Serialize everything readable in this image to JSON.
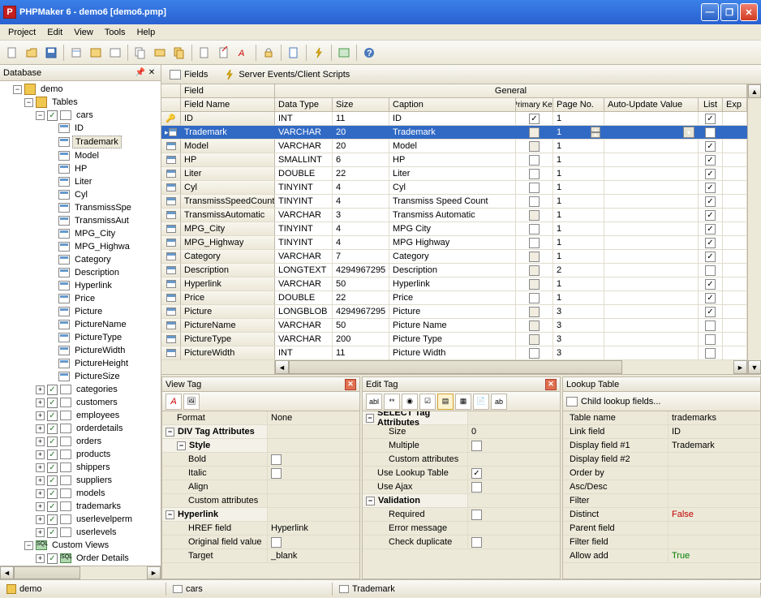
{
  "titlebar": {
    "app": "P",
    "title": "PHPMaker 6 - demo6 [demo6.pmp]"
  },
  "menu": [
    "Project",
    "Edit",
    "View",
    "Tools",
    "Help"
  ],
  "leftpane": {
    "title": "Database"
  },
  "tree": {
    "db": "demo",
    "tablesLabel": "Tables",
    "cars": "cars",
    "carFields": [
      "ID",
      "Trademark",
      "Model",
      "HP",
      "Liter",
      "Cyl",
      "TransmissSpe",
      "TransmissAut",
      "MPG_City",
      "MPG_Highwa",
      "Category",
      "Description",
      "Hyperlink",
      "Price",
      "Picture",
      "PictureName",
      "PictureType",
      "PictureWidth",
      "PictureHeight",
      "PictureSize"
    ],
    "tables": [
      "categories",
      "customers",
      "employees",
      "orderdetails",
      "orders",
      "products",
      "shippers",
      "suppliers",
      "models",
      "trademarks",
      "userlevelperm",
      "userlevels"
    ],
    "customViews": "Custom Views",
    "orderDetails": "Order Details"
  },
  "tabs": {
    "fields": "Fields",
    "events": "Server Events/Client Scripts"
  },
  "gridcols": {
    "field": "Field",
    "general": "General",
    "fieldName": "Field Name",
    "dataType": "Data Type",
    "size": "Size",
    "caption": "Caption",
    "pk": "Primary Key",
    "pageNo": "Page No.",
    "auto": "Auto-Update Value",
    "list": "List",
    "exp": "Exp"
  },
  "rows": [
    {
      "name": "ID",
      "dt": "INT",
      "sz": "11",
      "cap": "ID",
      "pk": true,
      "pg": "1",
      "pkdis": false,
      "list": true,
      "key": true
    },
    {
      "name": "Trademark",
      "dt": "VARCHAR",
      "sz": "20",
      "cap": "Trademark",
      "pk": false,
      "pg": "1",
      "pkdis": true,
      "list": true,
      "sel": true,
      "spin": true,
      "dd": true
    },
    {
      "name": "Model",
      "dt": "VARCHAR",
      "sz": "20",
      "cap": "Model",
      "pk": false,
      "pg": "1",
      "pkdis": true,
      "list": true
    },
    {
      "name": "HP",
      "dt": "SMALLINT",
      "sz": "6",
      "cap": "HP",
      "pk": false,
      "pg": "1",
      "list": true
    },
    {
      "name": "Liter",
      "dt": "DOUBLE",
      "sz": "22",
      "cap": "Liter",
      "pk": false,
      "pg": "1",
      "list": true
    },
    {
      "name": "Cyl",
      "dt": "TINYINT",
      "sz": "4",
      "cap": "Cyl",
      "pk": false,
      "pg": "1",
      "list": true
    },
    {
      "name": "TransmissSpeedCount",
      "dt": "TINYINT",
      "sz": "4",
      "cap": "Transmiss Speed Count",
      "pk": false,
      "pg": "1",
      "list": true
    },
    {
      "name": "TransmissAutomatic",
      "dt": "VARCHAR",
      "sz": "3",
      "cap": "Transmiss Automatic",
      "pk": false,
      "pg": "1",
      "pkdis": true,
      "list": true
    },
    {
      "name": "MPG_City",
      "dt": "TINYINT",
      "sz": "4",
      "cap": "MPG City",
      "pk": false,
      "pg": "1",
      "list": true
    },
    {
      "name": "MPG_Highway",
      "dt": "TINYINT",
      "sz": "4",
      "cap": "MPG Highway",
      "pk": false,
      "pg": "1",
      "list": true
    },
    {
      "name": "Category",
      "dt": "VARCHAR",
      "sz": "7",
      "cap": "Category",
      "pk": false,
      "pg": "1",
      "pkdis": true,
      "list": true
    },
    {
      "name": "Description",
      "dt": "LONGTEXT",
      "sz": "4294967295",
      "cap": "Description",
      "pk": false,
      "pg": "2",
      "pkdis": true,
      "list": false
    },
    {
      "name": "Hyperlink",
      "dt": "VARCHAR",
      "sz": "50",
      "cap": "Hyperlink",
      "pk": false,
      "pg": "1",
      "pkdis": true,
      "list": true
    },
    {
      "name": "Price",
      "dt": "DOUBLE",
      "sz": "22",
      "cap": "Price",
      "pk": false,
      "pg": "1",
      "list": true
    },
    {
      "name": "Picture",
      "dt": "LONGBLOB",
      "sz": "4294967295",
      "cap": "Picture",
      "pk": false,
      "pg": "3",
      "pkdis": true,
      "list": true
    },
    {
      "name": "PictureName",
      "dt": "VARCHAR",
      "sz": "50",
      "cap": "Picture Name",
      "pk": false,
      "pg": "3",
      "pkdis": true,
      "list": false
    },
    {
      "name": "PictureType",
      "dt": "VARCHAR",
      "sz": "200",
      "cap": "Picture Type",
      "pk": false,
      "pg": "3",
      "pkdis": true,
      "list": false
    },
    {
      "name": "PictureWidth",
      "dt": "INT",
      "sz": "11",
      "cap": "Picture Width",
      "pk": false,
      "pg": "3",
      "list": false
    }
  ],
  "viewtag": {
    "title": "View Tag",
    "format": "Format",
    "formatVal": "None",
    "div": "DIV Tag Attributes",
    "style": "Style",
    "bold": "Bold",
    "italic": "Italic",
    "align": "Align",
    "custom": "Custom attributes",
    "hyper": "Hyperlink",
    "href": "HREF field",
    "hrefVal": "Hyperlink",
    "orig": "Original field value",
    "target": "Target",
    "targetVal": "_blank"
  },
  "edittag": {
    "title": "Edit Tag",
    "select": "SELECT Tag Attributes",
    "size": "Size",
    "sizeVal": "0",
    "multiple": "Multiple",
    "custom": "Custom attributes",
    "uselookup": "Use Lookup Table",
    "useajax": "Use Ajax",
    "validation": "Validation",
    "required": "Required",
    "errmsg": "Error message",
    "checkdup": "Check duplicate"
  },
  "lookup": {
    "title": "Lookup Table",
    "child": "Child lookup fields...",
    "tablename": "Table name",
    "tablenameVal": "trademarks",
    "linkfield": "Link field",
    "linkfieldVal": "ID",
    "disp1": "Display field #1",
    "disp1Val": "Trademark",
    "disp2": "Display field #2",
    "orderby": "Order by",
    "ascdesc": "Asc/Desc",
    "filter": "Filter",
    "distinct": "Distinct",
    "distinctVal": "False",
    "parent": "Parent field",
    "filterfield": "Filter field",
    "allowadd": "Allow add",
    "allowaddVal": "True"
  },
  "status": {
    "db": "demo",
    "table": "cars",
    "field": "Trademark"
  }
}
